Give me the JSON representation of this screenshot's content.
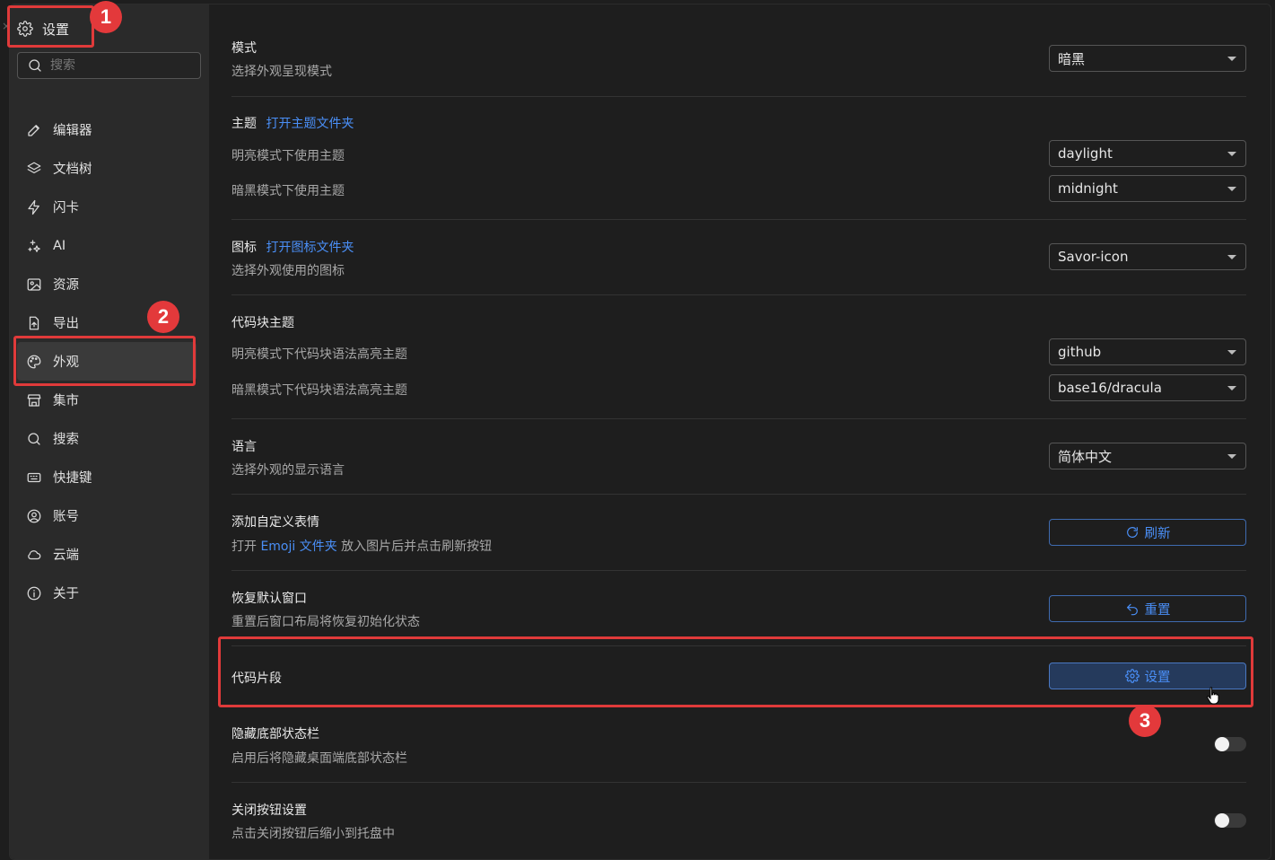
{
  "sidebar": {
    "title": "设置",
    "search_placeholder": "搜索",
    "items": [
      {
        "label": "编辑器",
        "icon": "pencil-icon"
      },
      {
        "label": "文档树",
        "icon": "layers-icon"
      },
      {
        "label": "闪卡",
        "icon": "lightning-icon"
      },
      {
        "label": "AI",
        "icon": "sparkle-icon"
      },
      {
        "label": "资源",
        "icon": "image-icon"
      },
      {
        "label": "导出",
        "icon": "export-file-icon"
      },
      {
        "label": "外观",
        "icon": "palette-icon",
        "active": true
      },
      {
        "label": "集市",
        "icon": "store-icon"
      },
      {
        "label": "搜索",
        "icon": "search-icon"
      },
      {
        "label": "快捷键",
        "icon": "keyboard-icon"
      },
      {
        "label": "账号",
        "icon": "user-circle-icon"
      },
      {
        "label": "云端",
        "icon": "cloud-icon"
      },
      {
        "label": "关于",
        "icon": "info-icon"
      }
    ]
  },
  "settings": {
    "mode": {
      "title": "模式",
      "desc": "选择外观呈现模式",
      "value": "暗黑"
    },
    "theme": {
      "title": "主题",
      "link": "打开主题文件夹",
      "light_label": "明亮模式下使用主题",
      "light_value": "daylight",
      "dark_label": "暗黑模式下使用主题",
      "dark_value": "midnight"
    },
    "icon": {
      "title": "图标",
      "link": "打开图标文件夹",
      "desc": "选择外观使用的图标",
      "value": "Savor-icon"
    },
    "code_theme": {
      "title": "代码块主题",
      "light_label": "明亮模式下代码块语法高亮主题",
      "light_value": "github",
      "dark_label": "暗黑模式下代码块语法高亮主题",
      "dark_value": "base16/dracula"
    },
    "language": {
      "title": "语言",
      "desc": "选择外观的显示语言",
      "value": "简体中文"
    },
    "emoji": {
      "title": "添加自定义表情",
      "desc_prefix": "打开 ",
      "desc_link": "Emoji 文件夹",
      "desc_suffix": " 放入图片后并点击刷新按钮",
      "button": "刷新"
    },
    "reset_window": {
      "title": "恢复默认窗口",
      "desc": "重置后窗口布局将恢复初始化状态",
      "button": "重置"
    },
    "snippets": {
      "title": "代码片段",
      "button": "设置"
    },
    "hide_statusbar": {
      "title": "隐藏底部状态栏",
      "desc": "启用后将隐藏桌面端底部状态栏",
      "enabled": false
    },
    "close_button": {
      "title": "关闭按钮设置",
      "desc": "点击关闭按钮后缩小到托盘中",
      "enabled": false
    }
  },
  "annotations": {
    "badge1": "1",
    "badge2": "2",
    "badge3": "3"
  },
  "colors": {
    "accent": "#4a8ff7",
    "highlight": "#e03a3a",
    "background": "#1e1e1e",
    "sidebar": "#2a2a2a"
  }
}
